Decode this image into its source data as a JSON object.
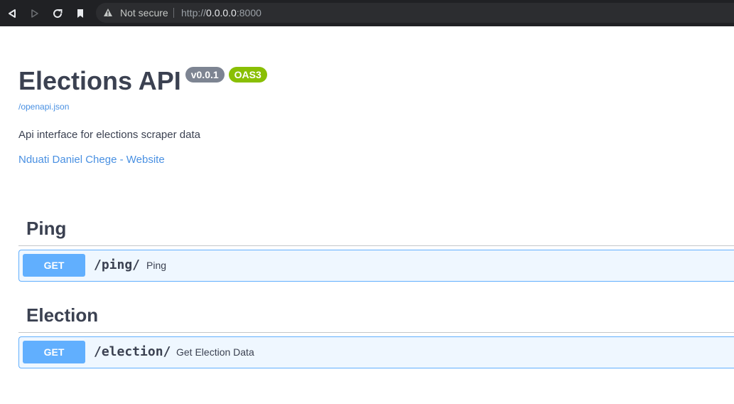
{
  "browser": {
    "security_label": "Not secure",
    "url_scheme": "http://",
    "url_host": "0.0.0.0",
    "url_port": ":8000",
    "icons": [
      "back-icon",
      "forward-icon",
      "reload-icon",
      "bookmark-icon",
      "warning-icon"
    ]
  },
  "info": {
    "title": "Elections API",
    "version_badge": "v0.0.1",
    "oas_badge": "OAS3",
    "spec_link": "/openapi.json",
    "description": "Api interface for elections scraper data",
    "contact_link": "Nduati Daniel Chege - Website"
  },
  "tags": [
    {
      "name": "Ping",
      "operations": [
        {
          "method": "GET",
          "path": "/ping/",
          "summary": "Ping"
        }
      ]
    },
    {
      "name": "Election",
      "operations": [
        {
          "method": "GET",
          "path": "/election/",
          "summary": "Get Election Data"
        }
      ]
    }
  ],
  "colors": {
    "toolbar_bg": "#202124",
    "text": "#3b4151",
    "link": "#4990e2",
    "get_method": "#61affe",
    "version_badge": "#7d8492",
    "oas_badge": "#89bf04"
  }
}
